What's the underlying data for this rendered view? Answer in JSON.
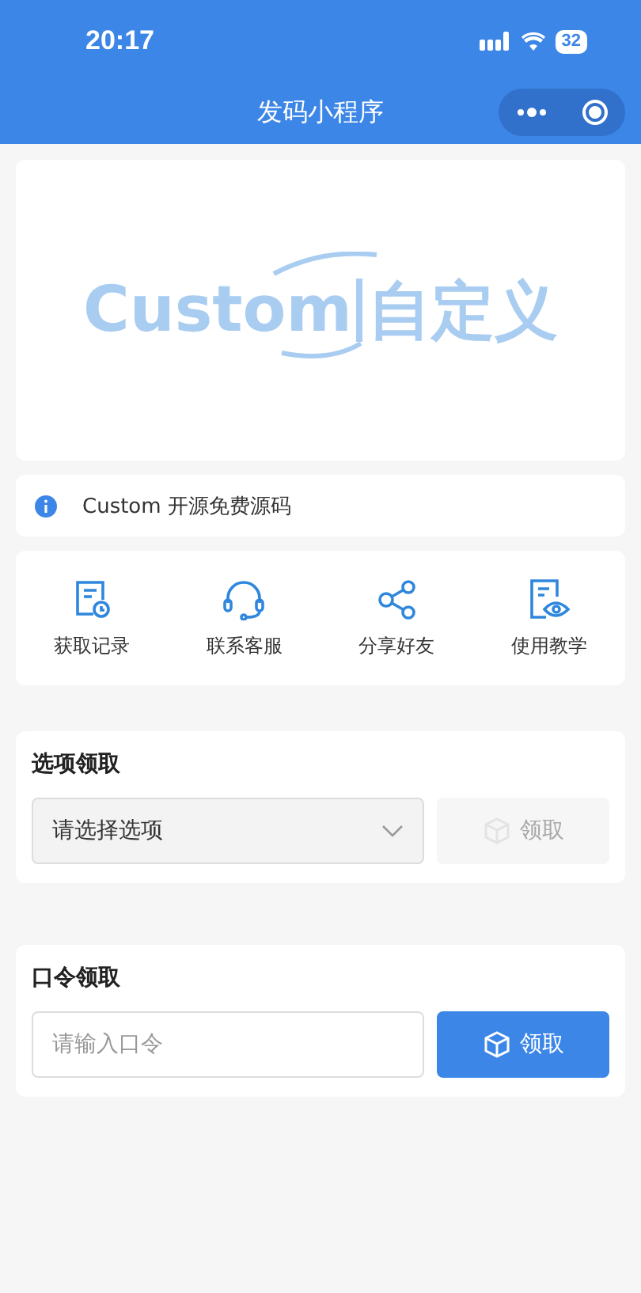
{
  "status_bar": {
    "time": "20:17",
    "battery": "32"
  },
  "nav": {
    "title": "发码小程序"
  },
  "banner": {
    "logo_left": "Custom",
    "logo_right": "自定义"
  },
  "notice": {
    "text": "Custom 开源免费源码"
  },
  "shortcuts": [
    {
      "kind": "record",
      "label": "获取记录"
    },
    {
      "kind": "service",
      "label": "联系客服"
    },
    {
      "kind": "share",
      "label": "分享好友"
    },
    {
      "kind": "guide",
      "label": "使用教学"
    }
  ],
  "option_claim": {
    "title": "选项领取",
    "select": {
      "placeholder": "请选择选项"
    },
    "button": {
      "label": "领取",
      "disabled": true
    }
  },
  "code_claim": {
    "title": "口令领取",
    "input": {
      "placeholder": "请输入口令"
    },
    "button": {
      "label": "领取",
      "disabled": false
    }
  }
}
